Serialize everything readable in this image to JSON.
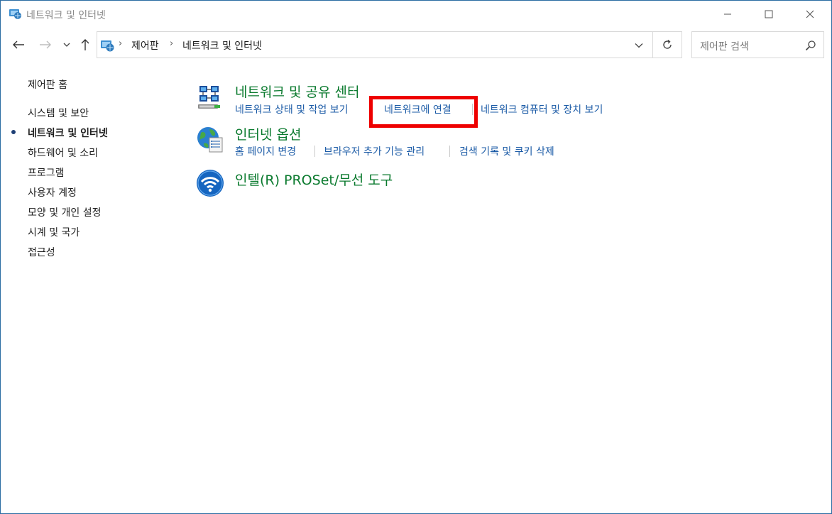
{
  "window": {
    "title": "네트워크 및 인터넷"
  },
  "nav": {
    "breadcrumb": [
      "제어판",
      "네트워크 및 인터넷"
    ],
    "search_placeholder": "제어판 검색"
  },
  "sidebar": {
    "items": [
      {
        "label": "제어판 홈"
      },
      {
        "label": "시스템 및 보안"
      },
      {
        "label": "네트워크 및 인터넷",
        "active": true
      },
      {
        "label": "하드웨어 및 소리"
      },
      {
        "label": "프로그램"
      },
      {
        "label": "사용자 계정"
      },
      {
        "label": "모양 및 개인 설정"
      },
      {
        "label": "시계 및 국가"
      },
      {
        "label": "접근성"
      }
    ]
  },
  "categories": [
    {
      "title": "네트워크 및 공유 센터",
      "icon": "network-sharing-center-icon",
      "links": [
        "네트워크 상태 및 작업 보기",
        "네트워크에 연결",
        "네트워크 컴퓨터 및 장치 보기"
      ]
    },
    {
      "title": "인터넷 옵션",
      "icon": "internet-options-globe-icon",
      "links": [
        "홈 페이지 변경",
        "브라우저 추가 기능 관리",
        "검색 기록 및 쿠키 삭제"
      ]
    },
    {
      "title": "인텔(R) PROSet/무선 도구",
      "icon": "intel-proset-wireless-icon",
      "links": []
    }
  ],
  "colors": {
    "category_title": "#0a7a2e",
    "link": "#1a5aa6",
    "highlight": "#ee0000",
    "window_border": "#2b6ca3"
  }
}
